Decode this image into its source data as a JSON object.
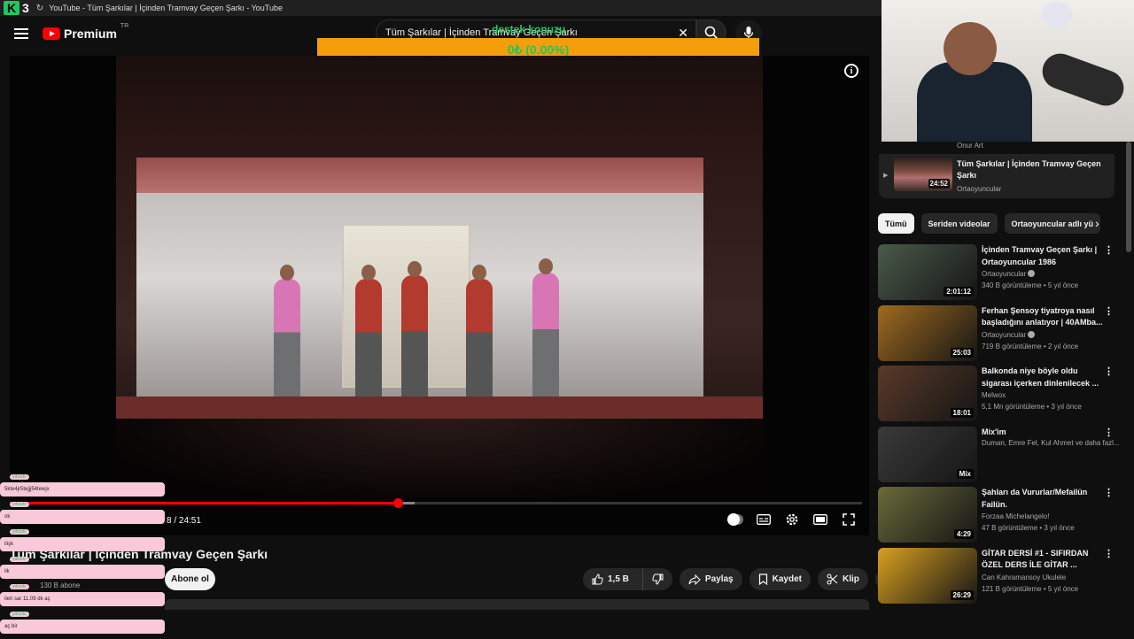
{
  "window": {
    "brand_letter": "K",
    "brand_number": "3",
    "title": "YouTube - Tüm Şarkılar | İçinden Tramvay Geçen Şarkı - YouTube"
  },
  "header": {
    "logo": "Premium",
    "logo_region": "TR",
    "search_value": "Tüm Şarkılar | İçinden Tramvay Geçen Şarkı"
  },
  "overlay": {
    "donate_title": "destek konuzu",
    "donate_value": "0₺ (0.00%)",
    "donate_progress": 0.0,
    "colors": {
      "bar": "#f59e0b",
      "text": "#22c55e"
    }
  },
  "player": {
    "time": "8 / 24:51",
    "progress_fraction": 0.455,
    "buffer_fraction": 0.475,
    "accent": "#ff0000"
  },
  "video": {
    "title": "Tüm Şarkılar | İçinden Tramvay Geçen Şarkı",
    "subscribers": "130 B abone",
    "subscribe_label": "Abone ol",
    "likes": "1,5 B",
    "share_label": "Paylaş",
    "save_label": "Kaydet",
    "clip_label": "Klip"
  },
  "chat": [
    {
      "user": "ydxxdc",
      "text": "5kte4jr5tejjj54tewjx"
    },
    {
      "user": "ydxxdc",
      "text": "ok"
    },
    {
      "user": "ydxxdc",
      "text": "ilişk"
    },
    {
      "user": "ydxxdc",
      "text": "ilk"
    },
    {
      "user": "ydxxdc",
      "text": "ileri sar 11.09 dk aç"
    },
    {
      "user": "ydxxdc",
      "text": "aç bir"
    }
  ],
  "playlist": {
    "header": "Onur Art",
    "item": {
      "title": "Tüm Şarkılar | İçinden Tramvay Geçen Şarkı",
      "channel": "Ortaoyuncular",
      "duration": "24:52"
    }
  },
  "chips": [
    "Tümü",
    "Seriden videolar",
    "Ortaoyuncular adlı yü"
  ],
  "recommendations": [
    {
      "title": "İçinden Tramvay Geçen Şarkı | Ortaoyuncular 1986",
      "channel": "Ortaoyuncular",
      "verified": true,
      "meta": "340 B görüntüleme • 5 yıl önce",
      "duration": "2:01:12",
      "thumb": "#4a5a4a"
    },
    {
      "title": "Ferhan Şensoy tiyatroya nasıl başladığını anlatıyor | 40AMba...",
      "channel": "Ortaoyuncular",
      "verified": true,
      "meta": "719 B görüntüleme • 2 yıl önce",
      "duration": "25:03",
      "thumb": "#a06a20"
    },
    {
      "title": "Balkonda niye böyle oldu sigarası içerken dinlenilecek ...",
      "channel": "Melwox",
      "verified": false,
      "meta": "5,1 Mn görüntüleme • 3 yıl önce",
      "duration": "18:01",
      "thumb": "#5a3a28"
    },
    {
      "title": "Mix'im",
      "channel": "Duman, Emre Fel, Kul Ahmet ve daha fazl...",
      "verified": false,
      "meta": "",
      "duration": "Mix",
      "thumb": "#3a3a3a",
      "single": true
    },
    {
      "title": "Şahları da Vururlar/Mefailün Failün.",
      "channel": "Forzaa Michelangelo!",
      "verified": false,
      "meta": "47 B görüntüleme • 3 yıl önce",
      "duration": "4:29",
      "thumb": "#6a6a3a"
    },
    {
      "title": "GİTAR DERSİ #1 - SIFIRDAN ÖZEL DERS İLE GİTAR ...",
      "channel": "Can Kahramansoy Ukulele",
      "verified": false,
      "meta": "121 B görüntüleme • 5 yıl önce",
      "duration": "26:29",
      "thumb": "#d8a020"
    }
  ]
}
